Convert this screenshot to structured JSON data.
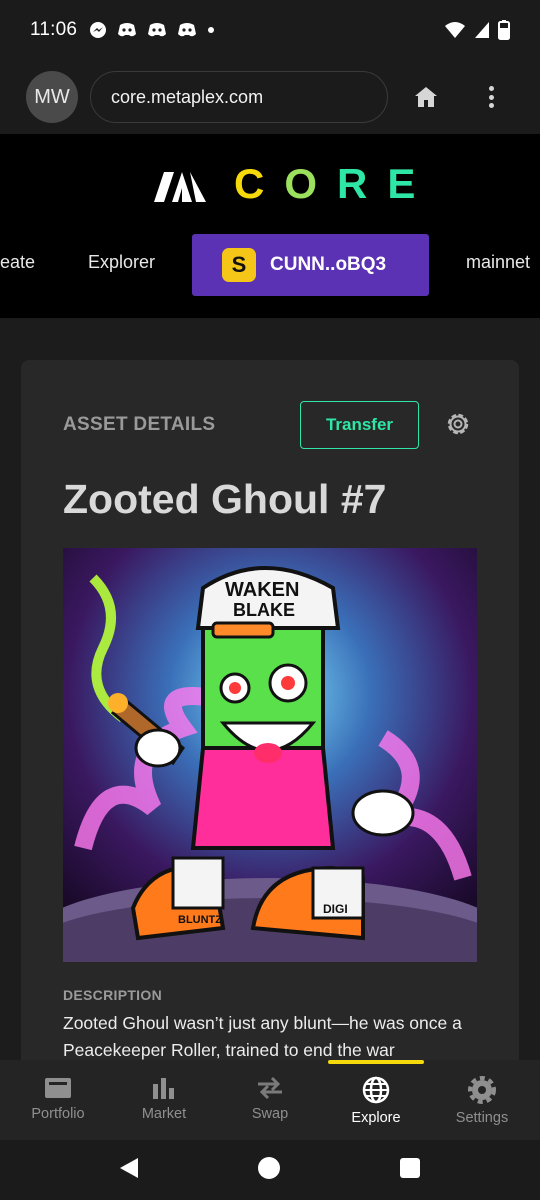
{
  "status_bar": {
    "time": "11:06"
  },
  "browser": {
    "avatar_initials": "MW",
    "url": "core.metaplex.com"
  },
  "site": {
    "logo_word": "CORE",
    "logo_colors": [
      "#f5d90a",
      "#9be15d",
      "#2ee6a6",
      "#2ee6a6"
    ],
    "nav": {
      "create_partial": "eate",
      "explorer": "Explorer",
      "wallet_label": "CUNN..oBQ3",
      "network_partial": "mainnet"
    },
    "accent_purple": "#5b32b3"
  },
  "asset": {
    "section_label": "ASSET DETAILS",
    "transfer_label": "Transfer",
    "title": "Zooted Ghoul #7",
    "description_label": "DESCRIPTION",
    "description": "Zooted Ghoul wasn’t just any blunt—he was once a Peacekeeper Roller, trained to end the war"
  },
  "image_text": {
    "hat_text_1": "WAKEN",
    "hat_text_2": "BLAKE",
    "shoe_left": "BLUNTZ",
    "shoe_right": "DIGI"
  },
  "bottom_nav": {
    "items": [
      {
        "label": "Portfolio",
        "icon": "wallet-icon"
      },
      {
        "label": "Market",
        "icon": "bar-chart-icon"
      },
      {
        "label": "Swap",
        "icon": "swap-arrows-icon"
      },
      {
        "label": "Explore",
        "icon": "globe-icon"
      },
      {
        "label": "Settings",
        "icon": "gear-icon"
      }
    ],
    "active": "Explore",
    "indicator_color": "#f5d90a"
  }
}
